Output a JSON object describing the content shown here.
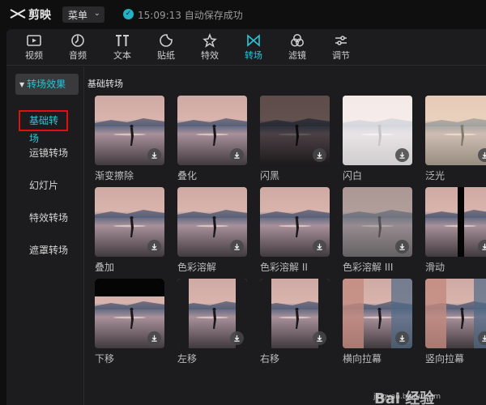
{
  "app": {
    "name": "剪映",
    "menu_label": "菜单",
    "save_time": "15:09:13",
    "save_text": "自动保存成功"
  },
  "toolbar": [
    {
      "label": "视频",
      "icon": "video-icon",
      "active": false
    },
    {
      "label": "音频",
      "icon": "audio-icon",
      "active": false
    },
    {
      "label": "文本",
      "icon": "text-icon",
      "active": false
    },
    {
      "label": "贴纸",
      "icon": "sticker-icon",
      "active": false
    },
    {
      "label": "特效",
      "icon": "effects-icon",
      "active": false
    },
    {
      "label": "转场",
      "icon": "transition-icon",
      "active": true
    },
    {
      "label": "滤镜",
      "icon": "filter-icon",
      "active": false
    },
    {
      "label": "调节",
      "icon": "adjust-icon",
      "active": false
    }
  ],
  "sidebar": {
    "group": "转场效果",
    "items": [
      "基础转场",
      "运镜转场",
      "幻灯片",
      "特效转场",
      "遮罩转场"
    ]
  },
  "section_title": "基础转场",
  "transitions": [
    "渐变擦除",
    "叠化",
    "闪黑",
    "闪白",
    "泛光",
    "叠加",
    "色彩溶解",
    "色彩溶解 II",
    "色彩溶解 III",
    "滑动",
    "下移",
    "左移",
    "右移",
    "横向拉幕",
    "竖向拉幕"
  ],
  "watermark": {
    "brand": "Bai 经验",
    "url": "jingyan.baidu.com"
  },
  "colors": {
    "accent": "#2bc7d8",
    "selection_box": "#e01010",
    "panel": "#1c1c1e"
  }
}
